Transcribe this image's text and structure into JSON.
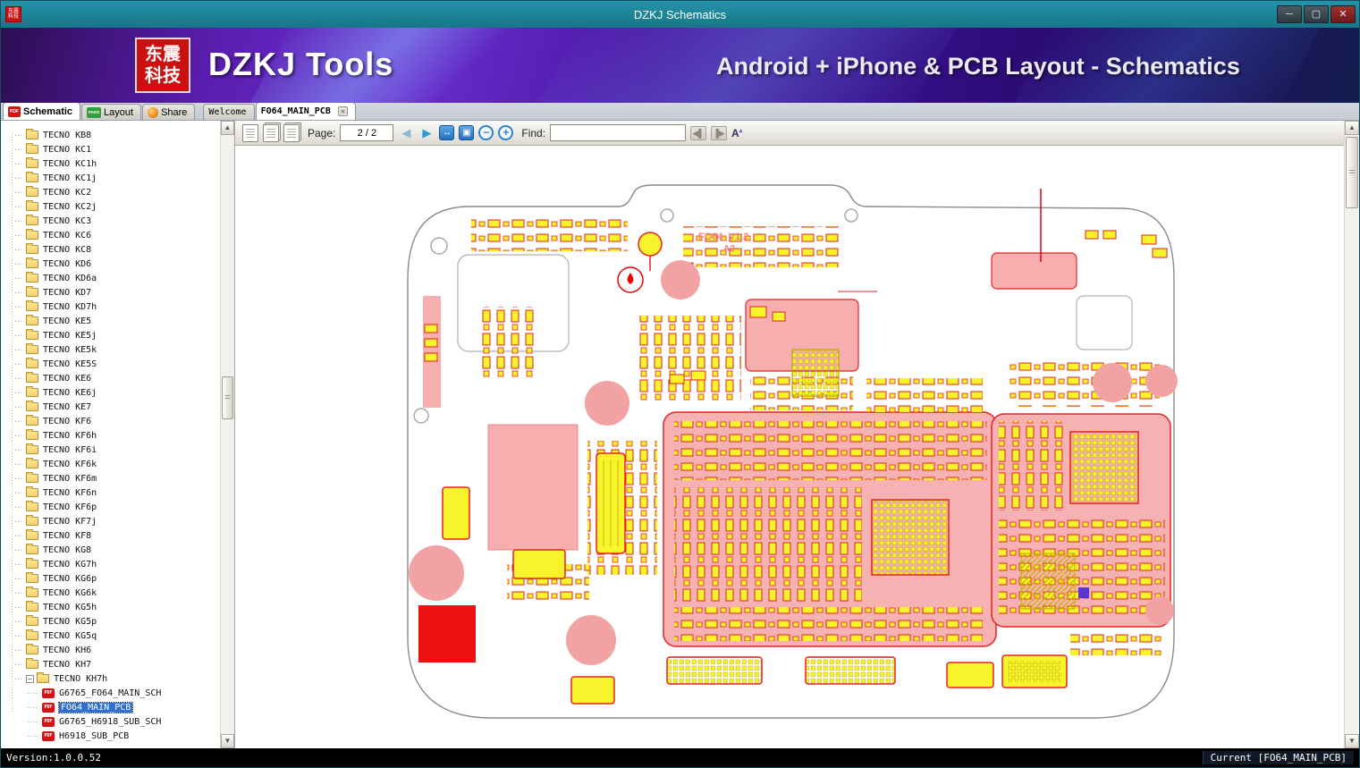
{
  "window": {
    "title": "DZKJ Schematics",
    "controls": {
      "minimize": "─",
      "maximize": "▢",
      "close": "✕"
    }
  },
  "banner": {
    "logo_line1": "东震",
    "logo_line2": "科技",
    "app_name": "DZKJ Tools",
    "subtitle": "Android + iPhone & PCB Layout - Schematics"
  },
  "app_tabs": [
    {
      "label": "Schematic",
      "icon": "pdf-badge"
    },
    {
      "label": "Layout",
      "icon": "pads-badge"
    },
    {
      "label": "Share",
      "icon": "share-ball"
    }
  ],
  "doc_tabs": [
    {
      "label": "Welcome"
    },
    {
      "label": "FO64_MAIN_PCB",
      "active": true,
      "closable": true
    }
  ],
  "toolbar": {
    "page_label": "Page:",
    "page_value": "2 / 2",
    "find_label": "Find:",
    "find_value": ""
  },
  "tree": [
    {
      "label": "TECNO KB8",
      "type": "folder"
    },
    {
      "label": "TECNO KC1",
      "type": "folder"
    },
    {
      "label": "TECNO KC1h",
      "type": "folder"
    },
    {
      "label": "TECNO KC1j",
      "type": "folder"
    },
    {
      "label": "TECNO KC2",
      "type": "folder"
    },
    {
      "label": "TECNO KC2j",
      "type": "folder"
    },
    {
      "label": "TECNO KC3",
      "type": "folder"
    },
    {
      "label": "TECNO KC6",
      "type": "folder"
    },
    {
      "label": "TECNO KC8",
      "type": "folder"
    },
    {
      "label": "TECNO KD6",
      "type": "folder"
    },
    {
      "label": "TECNO KD6a",
      "type": "folder"
    },
    {
      "label": "TECNO KD7",
      "type": "folder"
    },
    {
      "label": "TECNO KD7h",
      "type": "folder"
    },
    {
      "label": "TECNO KE5",
      "type": "folder"
    },
    {
      "label": "TECNO KE5j",
      "type": "folder"
    },
    {
      "label": "TECNO KE5k",
      "type": "folder"
    },
    {
      "label": "TECNO KE5S",
      "type": "folder"
    },
    {
      "label": "TECNO KE6",
      "type": "folder"
    },
    {
      "label": "TECNO KE6j",
      "type": "folder"
    },
    {
      "label": "TECNO KE7",
      "type": "folder"
    },
    {
      "label": "TECNO KF6",
      "type": "folder"
    },
    {
      "label": "TECNO KF6h",
      "type": "folder"
    },
    {
      "label": "TECNO KF6i",
      "type": "folder"
    },
    {
      "label": "TECNO KF6k",
      "type": "folder"
    },
    {
      "label": "TECNO KF6m",
      "type": "folder"
    },
    {
      "label": "TECNO KF6n",
      "type": "folder"
    },
    {
      "label": "TECNO KF6p",
      "type": "folder"
    },
    {
      "label": "TECNO KF7j",
      "type": "folder"
    },
    {
      "label": "TECNO KF8",
      "type": "folder"
    },
    {
      "label": "TECNO KG8",
      "type": "folder"
    },
    {
      "label": "TECNO KG7h",
      "type": "folder"
    },
    {
      "label": "TECNO KG6p",
      "type": "folder"
    },
    {
      "label": "TECNO KG6k",
      "type": "folder"
    },
    {
      "label": "TECNO KG5h",
      "type": "folder"
    },
    {
      "label": "TECNO KG5p",
      "type": "folder"
    },
    {
      "label": "TECNO KG5q",
      "type": "folder"
    },
    {
      "label": "TECNO KH6",
      "type": "folder"
    },
    {
      "label": "TECNO KH7",
      "type": "folder"
    },
    {
      "label": "TECNO KH7h",
      "type": "folder",
      "expanded": true
    },
    {
      "label": "G6765_FO64_MAIN_SCH",
      "type": "pdf"
    },
    {
      "label": "FO64_MAIN_PCB",
      "type": "pdf",
      "selected": true
    },
    {
      "label": "G6765_H6918_SUB_SCH",
      "type": "pdf"
    },
    {
      "label": "H6918_SUB_PCB",
      "type": "pdf"
    }
  ],
  "pcb": {
    "board_title": "FO64_V1.2",
    "board_rev": "A2",
    "colors": {
      "silk_pink": "#f6aeae",
      "component_yellow": "#f8f32b",
      "outline_red": "#e42222",
      "marker_red": "#ee1111"
    }
  },
  "statusbar": {
    "version": "Version:1.0.0.52",
    "current": "Current [FO64_MAIN_PCB]"
  }
}
